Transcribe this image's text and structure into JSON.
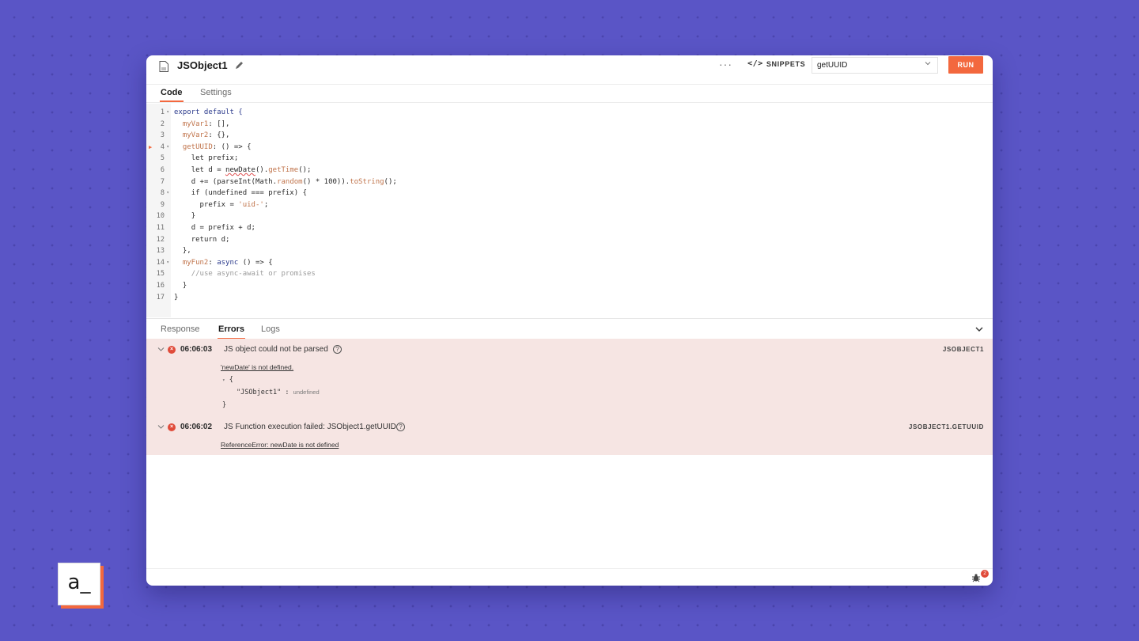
{
  "header": {
    "title": "JSObject1",
    "more_label": "···",
    "snippets_label": "SNIPPETS",
    "function_select": "getUUID",
    "run_label": "RUN"
  },
  "tabs": [
    {
      "label": "Code",
      "active": true
    },
    {
      "label": "Settings",
      "active": false
    }
  ],
  "code_lines": [
    {
      "n": "1",
      "fold": true
    },
    {
      "n": "2"
    },
    {
      "n": "3"
    },
    {
      "n": "4",
      "fold": true,
      "marker": true
    },
    {
      "n": "5"
    },
    {
      "n": "6"
    },
    {
      "n": "7"
    },
    {
      "n": "8",
      "fold": true
    },
    {
      "n": "9"
    },
    {
      "n": "10"
    },
    {
      "n": "11"
    },
    {
      "n": "12"
    },
    {
      "n": "13"
    },
    {
      "n": "14",
      "fold": true
    },
    {
      "n": "15"
    },
    {
      "n": "16"
    },
    {
      "n": "17"
    }
  ],
  "code": {
    "l1": "export default {",
    "l2a": "myVar1",
    "l2b": ": [],",
    "l3a": "myVar2",
    "l3b": ": {},",
    "l4a": "getUUID",
    "l4b": ": () => {",
    "l5": "let prefix;",
    "l6a": "let d = ",
    "l6b": "newDate",
    "l6c": "().",
    "l6d": "getTime",
    "l6e": "();",
    "l7a": "d += (parseInt(Math.",
    "l7b": "random",
    "l7c": "() * 100)).",
    "l7d": "toString",
    "l7e": "();",
    "l8": "if (undefined === prefix) {",
    "l9a": "prefix = ",
    "l9b": "'uid-'",
    "l9c": ";",
    "l10": "}",
    "l11": "d = prefix + d;",
    "l12": "return d;",
    "l13": "},",
    "l14a": "myFun2",
    "l14b": ": ",
    "l14c": "async",
    "l14d": " () => {",
    "l15": "//use async-await or promises",
    "l16": "}",
    "l17": "}"
  },
  "bottom_tabs": [
    {
      "label": "Response",
      "active": false
    },
    {
      "label": "Errors",
      "active": true
    },
    {
      "label": "Logs",
      "active": false
    }
  ],
  "errors": [
    {
      "time": "06:06:03",
      "message": "JS object could not be parsed",
      "source": "JSOBJECT1",
      "detail": "'newDate' is not defined.",
      "json_open": "{",
      "json_key": "\"JSObject1\"",
      "json_sep": ":",
      "json_value": "undefined",
      "json_close": "}"
    },
    {
      "time": "06:06:02",
      "message": "JS Function execution failed: JSObject1.getUUID",
      "source": "JSOBJECT1.GETUUID",
      "detail": "ReferenceError: newDate is not defined"
    }
  ],
  "footer": {
    "badge_count": "2"
  },
  "logo_text": "a_",
  "colors": {
    "accent": "#f3683e",
    "background": "#5a55c6",
    "error_bg": "#f6e5e3",
    "error_dot": "#e04b3a"
  }
}
